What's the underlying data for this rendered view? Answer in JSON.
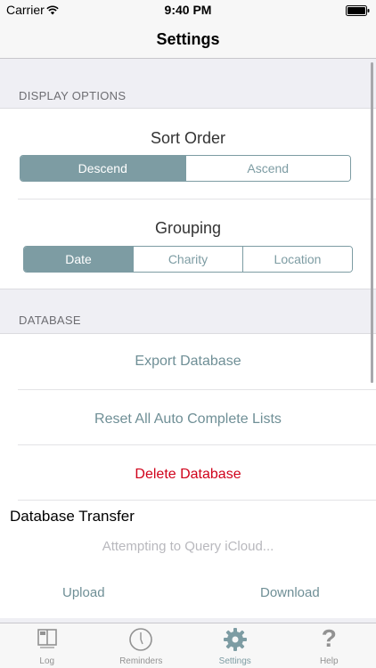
{
  "status_bar": {
    "carrier": "Carrier",
    "time": "9:40 PM",
    "wifi_icon": "wifi-icon",
    "battery_icon": "battery-icon"
  },
  "nav": {
    "title": "Settings"
  },
  "display_options": {
    "header": "DISPLAY OPTIONS",
    "sort_order": {
      "label": "Sort Order",
      "options": [
        "Descend",
        "Ascend"
      ],
      "selected": "Descend"
    },
    "grouping": {
      "label": "Grouping",
      "options": [
        "Date",
        "Charity",
        "Location"
      ],
      "selected": "Date"
    }
  },
  "database": {
    "header": "DATABASE",
    "export_label": "Export Database",
    "reset_label": "Reset All Auto Complete Lists",
    "delete_label": "Delete Database",
    "transfer": {
      "title": "Database Transfer",
      "status": "Attempting to Query iCloud...",
      "upload_label": "Upload",
      "download_label": "Download"
    }
  },
  "tabs": [
    {
      "label": "Log",
      "icon": "book-icon",
      "active": false
    },
    {
      "label": "Reminders",
      "icon": "clock-icon",
      "active": false
    },
    {
      "label": "Settings",
      "icon": "gear-icon",
      "active": true
    },
    {
      "label": "Help",
      "icon": "question-mark-icon",
      "active": false
    }
  ],
  "colors": {
    "accent": "#7d9ca3",
    "action_text": "#6f8f96",
    "danger": "#d0021b",
    "background": "#efeff4"
  }
}
